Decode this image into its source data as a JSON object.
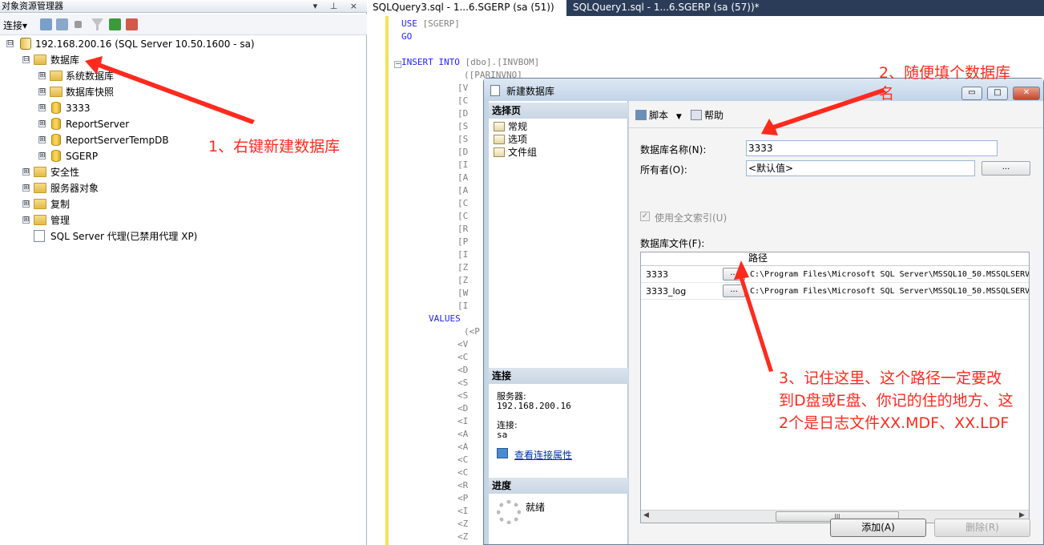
{
  "object_explorer": {
    "title": "对象资源管理器",
    "title_buttons": "▾ ⊥ ×",
    "connect_label": "连接▾",
    "tree": [
      {
        "label": "192.168.200.16 (SQL Server 10.50.1600 - sa)",
        "expander": "⊟"
      },
      {
        "label": "数据库",
        "expander": "⊟"
      },
      {
        "label": "系统数据库",
        "expander": "⊞"
      },
      {
        "label": "数据库快照",
        "expander": "⊞"
      },
      {
        "label": "3333",
        "expander": "⊞"
      },
      {
        "label": "ReportServer",
        "expander": "⊞"
      },
      {
        "label": "ReportServerTempDB",
        "expander": "⊞"
      },
      {
        "label": "SGERP",
        "expander": "⊞"
      },
      {
        "label": "安全性",
        "expander": "⊞"
      },
      {
        "label": "服务器对象",
        "expander": "⊞"
      },
      {
        "label": "复制",
        "expander": "⊞"
      },
      {
        "label": "管理",
        "expander": "⊞"
      },
      {
        "label": "SQL Server 代理(已禁用代理 XP)",
        "expander": ""
      }
    ]
  },
  "editor": {
    "tabs": [
      "SQLQuery3.sql - 1...6.SGERP (sa (51))",
      "SQLQuery1.sql - 1...6.SGERP (sa (57))*"
    ],
    "code": {
      "use_kw": "USE",
      "use_db": "[SGERP]",
      "go": "GO",
      "insert_kw": "INSERT INTO",
      "insert_target": "[dbo].[INVBOM]",
      "first_col": "([PARINVNO]",
      "values_kw": "VALUES",
      "first_val": "(<P"
    },
    "column_frags": [
      "[V",
      "[C",
      "[D",
      "[S",
      "[S",
      "[D",
      "[I",
      "[A",
      "[A",
      "[C",
      "[C",
      "[R",
      "[P",
      "[I",
      "[Z",
      "[Z",
      "[W",
      "[I"
    ],
    "value_frags": [
      "<V",
      "<C",
      "<D",
      "<S",
      "<S",
      "<D",
      "<I",
      "<A",
      "<A",
      "<C",
      "<C",
      "<R",
      "<P",
      "<I",
      "<Z",
      "<Z"
    ]
  },
  "dialog": {
    "title": "新建数据库",
    "window_buttons": [
      "▭",
      "□",
      "✕"
    ],
    "select_page_header": "选择页",
    "pages": [
      "常规",
      "选项",
      "文件组"
    ],
    "connection_header": "连接",
    "server_label": "服务器:",
    "server_value": "192.168.200.16",
    "connection_label": "连接:",
    "connection_value": "sa",
    "view_props_link": "查看连接属性",
    "progress_header": "进度",
    "progress_status": "就绪",
    "toolbar": {
      "script": "脚本",
      "help": "帮助"
    },
    "db_name_label": "数据库名称(N):",
    "db_name_value": "3333",
    "owner_label": "所有者(O):",
    "owner_value": "<默认值>",
    "browse_label": "...",
    "fulltext_label": "使用全文索引(U)",
    "db_files_label": "数据库文件(F):",
    "grid_header_path": "路径",
    "files": [
      {
        "name": "3333",
        "path": "C:\\Program Files\\Microsoft SQL Server\\MSSQL10_50.MSSQLSERV"
      },
      {
        "name": "3333_log",
        "path": "C:\\Program Files\\Microsoft SQL Server\\MSSQL10_50.MSSQLSERV"
      }
    ],
    "add_button": "添加(A)",
    "remove_button": "删除(R)",
    "scroll_thumb": "III"
  },
  "annotations": {
    "step1": "1、右键新建数据库",
    "step2_line1": "2、随便填个数据库",
    "step2_line2": "名",
    "step3_line1": "3、记住这里、这个路径一定要改",
    "step3_line2": "到D盘或E盘、你记的住的地方、这",
    "step3_line3": "2个是日志文件XX.MDF、XX.LDF",
    "color": "#ff2a1e"
  }
}
